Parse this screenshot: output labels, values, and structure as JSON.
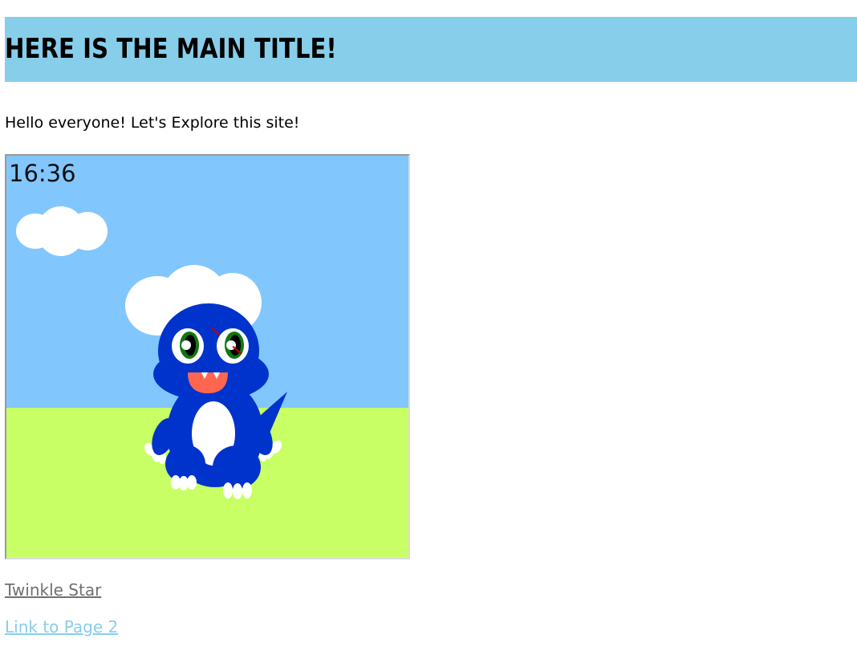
{
  "header": {
    "title": "HERE IS THE MAIN TITLE!"
  },
  "intro": {
    "text": "Hello everyone! Let's Explore this site!"
  },
  "canvas": {
    "clock_text": "16:36",
    "sky_color": "#82c6fe",
    "grass_color": "#c8ff64",
    "character_color": "#0033cc",
    "cloud_color": "#ffffff"
  },
  "links": {
    "twinkle_star": "Twinkle Star",
    "page2": "Link to Page 2"
  }
}
